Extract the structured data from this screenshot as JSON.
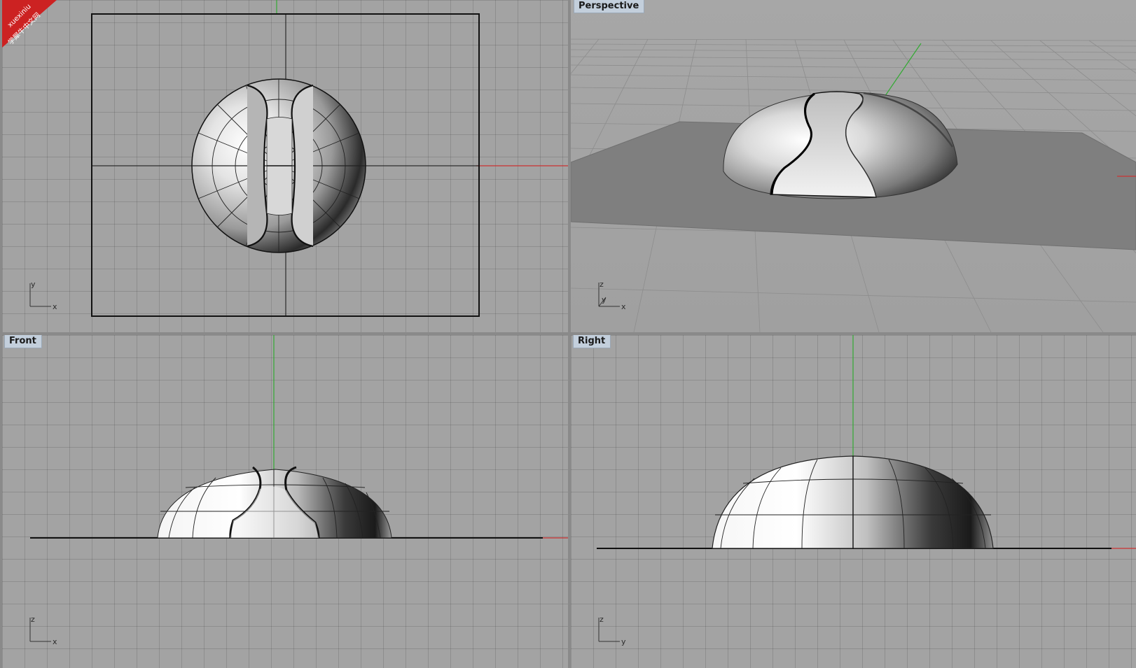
{
  "watermark": {
    "text_en": "xuexiniu",
    "text_cn": "学犀牛中文网",
    "color": "#cc2222"
  },
  "viewports": {
    "top": {
      "label": "",
      "axis_h": "x",
      "axis_v": "y"
    },
    "perspective": {
      "label": "Perspective",
      "axis_h": "x",
      "axis_d": "y",
      "axis_v": "z"
    },
    "front": {
      "label": "Front",
      "axis_h": "x",
      "axis_v": "z"
    },
    "right": {
      "label": "Right",
      "axis_h": "y",
      "axis_v": "z"
    }
  },
  "colors": {
    "viewport_bg": "#a3a3a3",
    "grid_line": "#8f8f8f",
    "x_axis": "#cc3333",
    "y_axis": "#33aa33",
    "label_bg": "#c3cfdc",
    "border": "#8a8a8a"
  },
  "icons": {
    "axis_triad": "cplane-axis-icon"
  }
}
